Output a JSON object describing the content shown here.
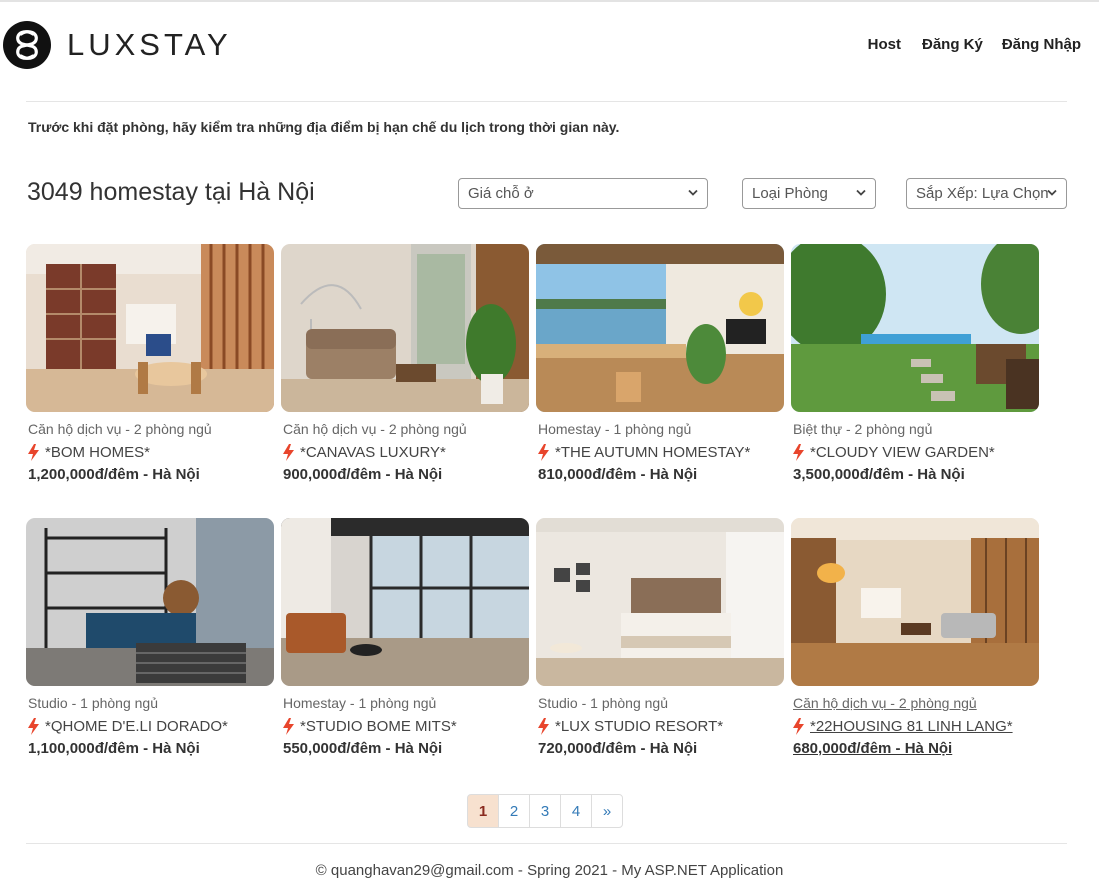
{
  "brand": {
    "name": "LUXSTAY"
  },
  "nav": {
    "host": "Host",
    "register": "Đăng Ký",
    "login": "Đăng Nhập"
  },
  "notice": "Trước khi đặt phòng, hãy kiểm tra những địa điểm bị hạn chế du lịch trong thời gian này.",
  "heading": "3049 homestay tại Hà Nội",
  "filters": {
    "price": "Giá chỗ ở",
    "room_type": "Loại Phòng",
    "sort": "Sắp Xếp: Lựa Chọn"
  },
  "listings": [
    {
      "type": "Căn hộ dịch vụ - 2 phòng ngủ",
      "name": "*BOM HOMES*",
      "price": "1,200,000đ/đêm - Hà Nội"
    },
    {
      "type": "Căn hộ dịch vụ - 2 phòng ngủ",
      "name": "*CANAVAS LUXURY*",
      "price": "900,000đ/đêm - Hà Nội"
    },
    {
      "type": "Homestay - 1 phòng ngủ",
      "name": "*THE AUTUMN HOMESTAY*",
      "price": "810,000đ/đêm - Hà Nội"
    },
    {
      "type": "Biệt thự - 2 phòng ngủ",
      "name": "*CLOUDY VIEW GARDEN*",
      "price": "3,500,000đ/đêm - Hà Nội"
    },
    {
      "type": "Studio - 1 phòng ngủ",
      "name": "*QHOME D'E.LI DORADO*",
      "price": "1,100,000đ/đêm - Hà Nội"
    },
    {
      "type": "Homestay - 1 phòng ngủ",
      "name": "*STUDIO BOME MITS*",
      "price": "550,000đ/đêm - Hà Nội"
    },
    {
      "type": "Studio - 1 phòng ngủ",
      "name": "*LUX STUDIO RESORT*",
      "price": "720,000đ/đêm - Hà Nội"
    },
    {
      "type": "Căn hộ dịch vụ - 2 phòng ngủ",
      "name": "*22HOUSING 81 LINH LANG*",
      "price": "680,000đ/đêm - Hà Nội"
    }
  ],
  "pagination": {
    "pages": [
      "1",
      "2",
      "3",
      "4"
    ],
    "next": "»",
    "current": "1"
  },
  "footer": "© quanghavan29@gmail.com - Spring 2021 - My ASP.NET Application",
  "colors": {
    "accent_bolt": "#e8452c",
    "link": "#337ab7",
    "active_page_bg": "#f7e1cf"
  }
}
